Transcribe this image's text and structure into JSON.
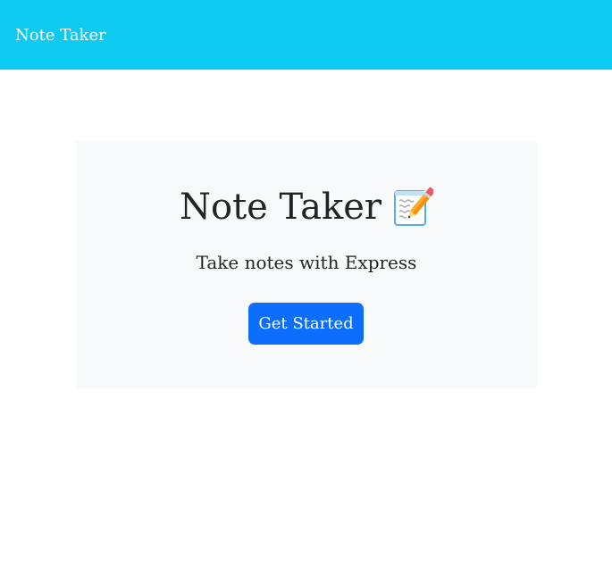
{
  "navbar": {
    "brand": "Note Taker",
    "background_color": "#0dcaf0"
  },
  "hero": {
    "title": "Note Taker",
    "title_icon": "memo-icon",
    "subtitle": "Take notes with Express",
    "cta_label": "Get Started",
    "cta_color": "#0d6efd"
  }
}
